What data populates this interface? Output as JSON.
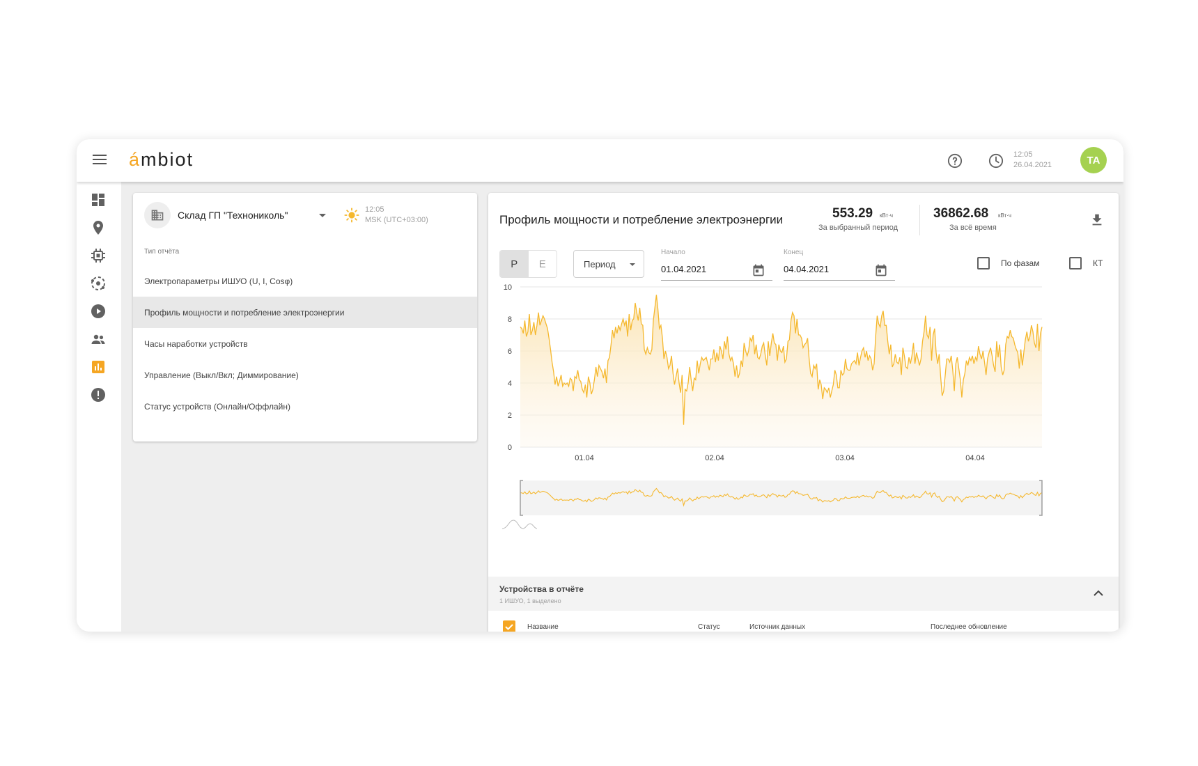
{
  "app": {
    "logo_first": "á",
    "logo_rest": "mbiot",
    "clock_time": "12:05",
    "clock_date": "26.04.2021",
    "avatar_initials": "TA"
  },
  "nav_icons": [
    "dashboard-icon",
    "map-pin-icon",
    "chip-icon",
    "network-icon",
    "play-icon",
    "people-icon",
    "bar-chart-icon",
    "alert-icon"
  ],
  "site": {
    "name": "Склад ГП \"Технониколь\"",
    "time": "12:05",
    "timezone": "MSK (UTC+03:00)"
  },
  "reports": {
    "label": "Тип отчёта",
    "items": [
      "Электропараметры ИШУО (U, I, Cosφ)",
      "Профиль мощности и потребление электроэнергии",
      "Часы наработки устройств",
      "Управление (Выкл/Вкл; Диммирование)",
      "Статус устройств (Онлайн/Оффлайн)"
    ],
    "active_index": 1
  },
  "main": {
    "title": "Профиль мощности и потребление электроэнергии",
    "stat_period_value": "553.29",
    "stat_period_unit": "кВт·ч",
    "stat_period_label": "За выбранный период",
    "stat_total_value": "36862.68",
    "stat_total_unit": "кВт·ч",
    "stat_total_label": "За всё время"
  },
  "controls": {
    "toggle_p": "P",
    "toggle_e": "E",
    "period": "Период",
    "start_label": "Начало",
    "start_value": "01.04.2021",
    "end_label": "Конец",
    "end_value": "04.04.2021",
    "by_phase": "По фазам",
    "kt": "КТ"
  },
  "chart_data": {
    "type": "area",
    "title": "",
    "xlabel": "",
    "ylabel": "",
    "x_ticks": [
      "01.04",
      "02.04",
      "03.04",
      "04.04"
    ],
    "ylim": [
      0,
      10
    ],
    "y_ticks": [
      0,
      2,
      4,
      6,
      8,
      10
    ],
    "grid": true,
    "color": "#f5b82e",
    "series": [
      {
        "values": [
          7.5,
          7.4,
          7.1,
          7.9,
          6.9,
          7.2,
          8.3,
          7.0,
          7.3,
          7.8,
          7.0,
          7.6,
          8.4,
          7.6,
          7.9,
          8.2,
          8.0,
          7.7,
          7.4,
          6.8,
          6.1,
          5.3,
          4.7,
          3.9,
          4.4,
          3.8,
          4.1,
          4.5,
          3.8,
          4.0,
          3.9,
          4.0,
          3.8,
          4.3,
          4.2,
          3.5,
          4.4,
          4.3,
          4.8,
          4.2,
          4.1,
          3.6,
          3.4,
          3.9,
          3.1,
          4.4,
          4.0,
          3.3,
          3.6,
          4.2,
          5.0,
          4.4,
          5.1,
          4.9,
          4.7,
          4.3,
          4.9,
          4.0,
          5.4,
          5.6,
          6.4,
          7.3,
          6.8,
          7.5,
          7.1,
          7.6,
          7.3,
          7.7,
          8.0,
          7.6,
          7.9,
          6.9,
          8.3,
          7.3,
          7.9,
          8.0,
          9.0,
          8.4,
          7.9,
          8.7,
          7.7,
          7.6,
          6.1,
          5.8,
          6.2,
          5.9,
          5.8,
          6.1,
          7.9,
          8.7,
          9.5,
          8.6,
          7.4,
          7.6,
          6.8,
          5.5,
          6.0,
          5.6,
          4.9,
          5.1,
          5.7,
          4.6,
          3.9,
          4.4,
          4.9,
          4.0,
          3.4,
          4.5,
          1.4,
          3.6,
          3.5,
          4.0,
          5.0,
          4.2,
          3.5,
          4.3,
          4.2,
          5.4,
          4.6,
          5.2,
          5.6,
          5.4,
          5.5,
          5.6,
          5.2,
          4.8,
          5.5,
          5.5,
          6.1,
          5.3,
          5.9,
          5.4,
          6.3,
          6.0,
          5.5,
          6.6,
          6.1,
          6.9,
          5.8,
          5.4,
          5.6,
          5.2,
          4.4,
          5.1,
          4.3,
          4.6,
          5.4,
          5.0,
          6.5,
          6.0,
          5.7,
          6.0,
          6.8,
          6.6,
          7.0,
          5.8,
          6.4,
          5.6,
          5.5,
          5.8,
          6.3,
          6.5,
          5.7,
          5.1,
          6.6,
          5.7,
          6.5,
          7.1,
          6.5,
          6.4,
          5.4,
          6.4,
          6.0,
          5.9,
          6.3,
          5.3,
          5.5,
          6.6,
          6.7,
          7.9,
          8.4,
          8.2,
          7.1,
          8.0,
          7.0,
          7.0,
          6.8,
          6.2,
          6.4,
          6.5,
          6.8,
          5.5,
          4.6,
          4.4,
          5.1,
          4.9,
          5.2,
          3.6,
          4.2,
          3.9,
          3.0,
          3.7,
          3.6,
          3.4,
          3.7,
          3.1,
          3.5,
          3.9,
          4.8,
          4.5,
          3.7,
          3.7,
          4.8,
          4.5,
          4.6,
          5.5,
          4.9,
          4.8,
          4.8,
          5.2,
          5.3,
          5.4,
          5.2,
          5.9,
          5.1,
          5.6,
          6.0,
          6.2,
          5.6,
          6.0,
          5.4,
          5.7,
          5.5,
          4.8,
          5.2,
          6.9,
          8.2,
          7.7,
          7.5,
          8.2,
          8.5,
          7.6,
          7.6,
          6.6,
          5.8,
          6.4,
          5.0,
          5.2,
          5.8,
          5.3,
          5.2,
          5.6,
          4.5,
          6.2,
          5.7,
          5.0,
          4.9,
          5.6,
          5.2,
          5.7,
          6.5,
          5.2,
          5.9,
          5.5,
          5.1,
          5.5,
          6.6,
          7.2,
          8.2,
          7.0,
          6.8,
          7.5,
          5.4,
          7.0,
          7.4,
          5.9,
          5.2,
          5.8,
          4.4,
          3.2,
          3.5,
          4.5,
          5.5,
          5.5,
          5.3,
          5.7,
          4.8,
          3.5,
          5.2,
          5.6,
          4.9,
          4.2,
          3.1,
          4.2,
          4.6,
          5.4,
          5.1,
          5.6,
          5.4,
          5.7,
          5.2,
          5.6,
          5.4,
          6.3,
          5.8,
          5.5,
          6.0,
          5.3,
          4.5,
          5.5,
          5.9,
          6.2,
          5.7,
          5.1,
          4.7,
          6.6,
          5.6,
          6.4,
          5.0,
          4.5,
          4.8,
          6.4,
          6.9,
          6.8,
          7.3,
          6.9,
          6.8,
          6.4,
          6.1,
          5.9,
          4.9,
          6.1,
          5.1,
          5.9,
          6.7,
          7.2,
          6.6,
          6.9,
          7.6,
          7.2,
          6.5,
          6.2,
          7.7,
          6.0,
          7.1,
          7.5
        ]
      }
    ]
  },
  "devices": {
    "title": "Устройства в отчёте",
    "subtitle": "1 ИШУО, 1 выделено",
    "columns": [
      "Название",
      "Статус",
      "Источник данных",
      "Последнее обновление"
    ]
  }
}
